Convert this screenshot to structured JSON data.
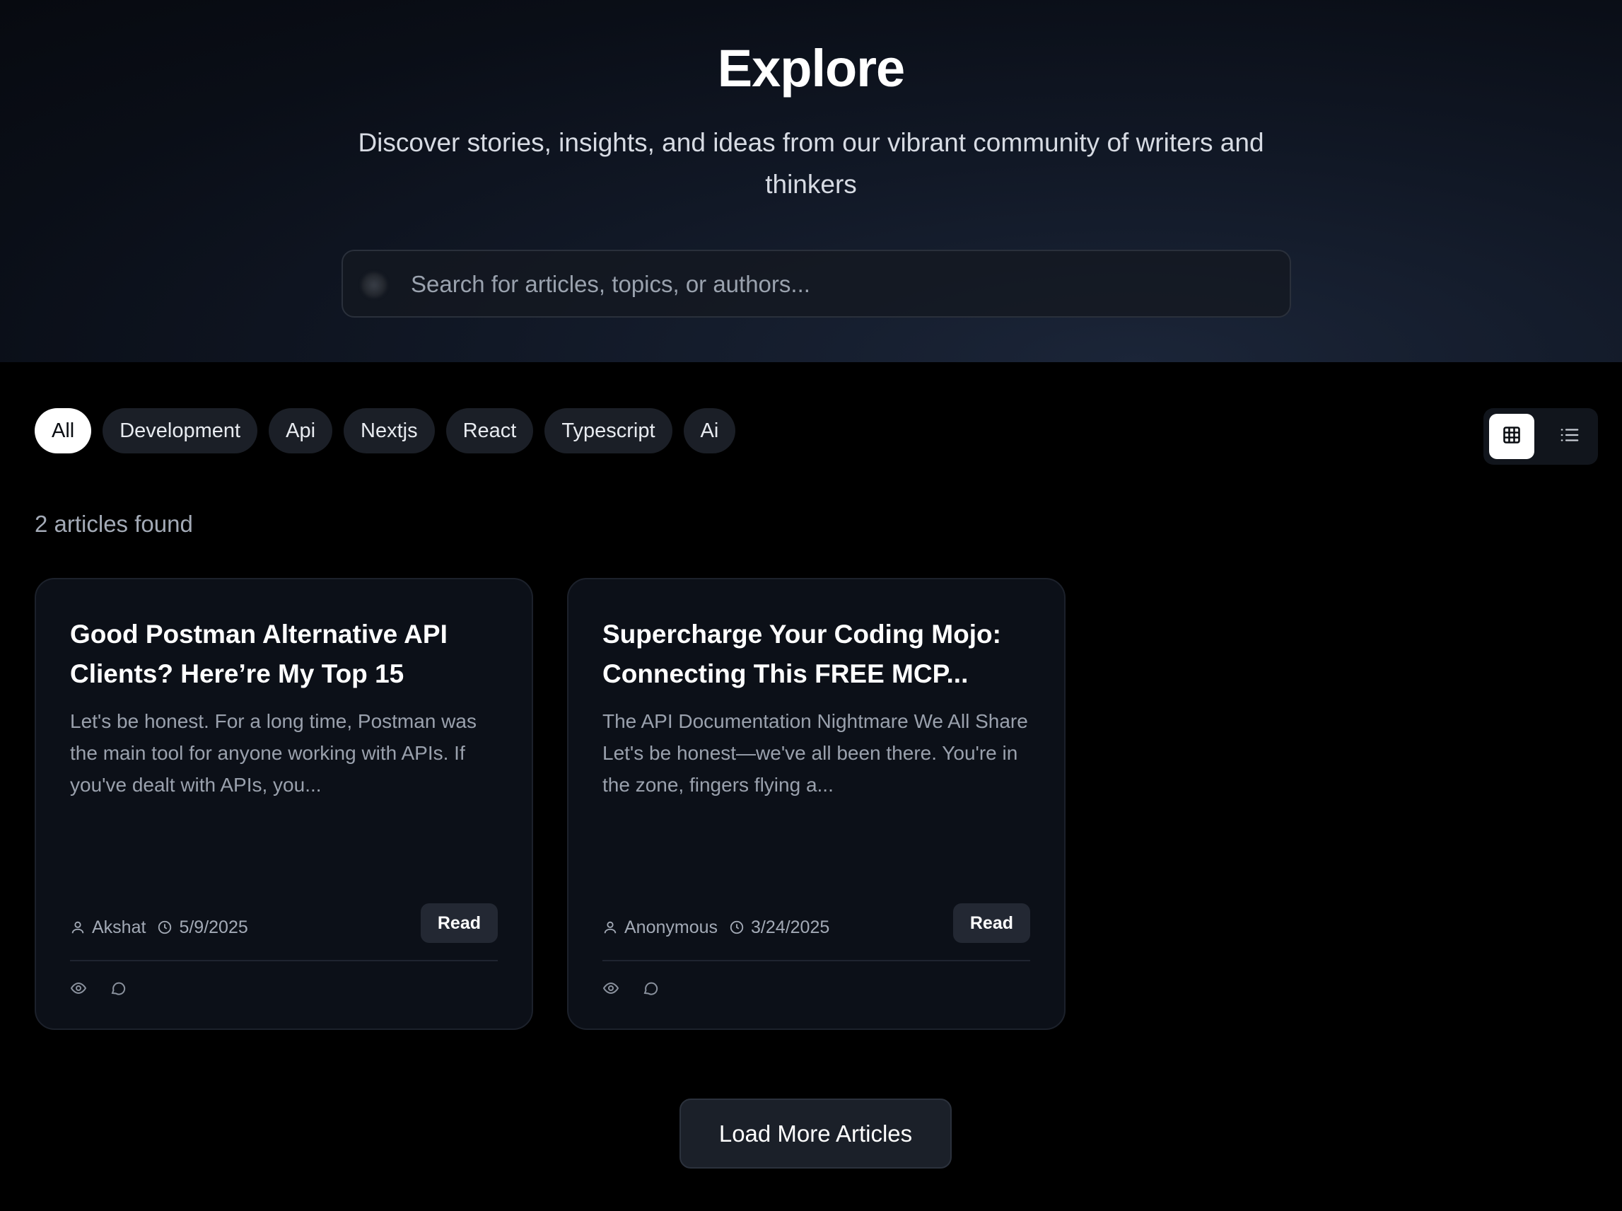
{
  "hero": {
    "title": "Explore",
    "subtitle": "Discover stories, insights, and ideas from our vibrant community of writers and thinkers"
  },
  "search": {
    "placeholder": "Search for articles, topics, or authors...",
    "value": ""
  },
  "filters": [
    "All",
    "Development",
    "Api",
    "Nextjs",
    "React",
    "Typescript",
    "Ai"
  ],
  "active_filter": "All",
  "view_toggle": {
    "selected": "grid",
    "options": [
      "grid-icon",
      "list-icon"
    ]
  },
  "results": {
    "count_label": "2 articles found"
  },
  "articles": [
    {
      "title": "Good Postman Alternative API Clients? Here’re My Top 15",
      "excerpt": "Let's be honest. For a long time, Postman was the main tool for anyone working with APIs. If you've dealt with APIs, you...",
      "author": "Akshat",
      "date": "5/9/2025",
      "read_label": "Read"
    },
    {
      "title": "Supercharge Your Coding Mojo: Connecting This FREE MCP...",
      "excerpt": "The API Documentation Nightmare We All Share Let's be honest—we've all been there. You're in the zone, fingers flying a...",
      "author": "Anonymous",
      "date": "3/24/2025",
      "read_label": "Read"
    }
  ],
  "load_more_label": "Load More Articles",
  "colors": {
    "background": "#000000",
    "card": "#0c1018",
    "chip": "#1b1f27",
    "chip_active": "#ffffff",
    "muted_text": "#9aa1ad"
  }
}
